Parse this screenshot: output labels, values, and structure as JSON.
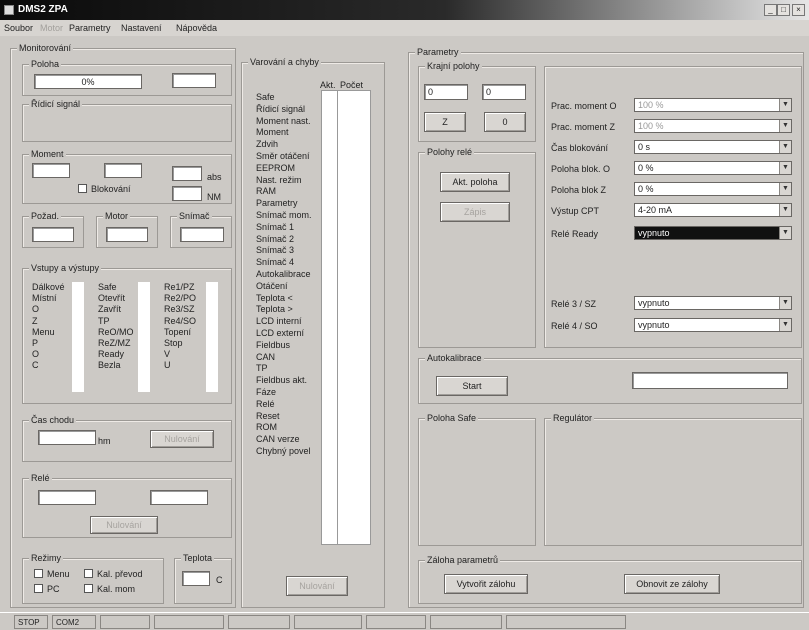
{
  "title": "DMS2 ZPA",
  "menu": [
    "Soubor",
    "Motor",
    "Parametry",
    "Nastavení",
    "Nápověda"
  ],
  "left": {
    "monitorovani": "Monitorování",
    "poloha": {
      "label": "Poloha",
      "value": "0%",
      "value2": ""
    },
    "ridici": "Řídicí signál",
    "moment": {
      "label": "Moment",
      "unit1": "abs",
      "unit2": "NM",
      "blokovani": "Blokování"
    },
    "pozad": "Požad.",
    "motor": "Motor",
    "snimac": "Snímač",
    "vstupy": {
      "label": "Vstupy a výstupy",
      "col1": [
        "Dálkové",
        "Místní",
        "O",
        "Z",
        "Menu",
        "P",
        "O",
        "C"
      ],
      "col2": [
        "Safe",
        "Otevřít",
        "Zavřít",
        "TP",
        "ReO/MO",
        "ReZ/MZ",
        "Ready",
        "Bezla"
      ],
      "col3": [
        "Re1/PZ",
        "Re2/PO",
        "Re3/SZ",
        "Re4/SO",
        "Topení",
        "Stop",
        "V",
        "U"
      ]
    },
    "cas": {
      "label": "Čas chodu",
      "unit": "hm",
      "button": "Nulování"
    },
    "rele": {
      "label": "Relé",
      "button": "Nulování"
    },
    "rezimy": {
      "label": "Režimy",
      "menu": "Menu",
      "pc": "PC",
      "kal_prev": "Kal. převod",
      "kal_mom": "Kal. mom"
    },
    "teplota": {
      "label": "Teplota",
      "unit": "C"
    }
  },
  "varovani": {
    "label": "Varování a chyby",
    "col_akt": "Akt.",
    "col_pocet": "Počet",
    "items": [
      "Safe",
      "Řídicí signál",
      "Moment nast.",
      "Moment",
      "Zdvih",
      "Směr otáčení",
      "EEPROM",
      "Nast. režim",
      "RAM",
      "Parametry",
      "Snímač mom.",
      "Snímač 1",
      "Snímač 2",
      "Snímač 3",
      "Snímač 4",
      "Autokalibrace",
      "Otáčení",
      "Teplota <",
      "Teplota >",
      "LCD interní",
      "LCD externí",
      "Fieldbus",
      "CAN",
      "TP",
      "Fieldbus akt.",
      "Fáze",
      "Relé",
      "Reset",
      "ROM",
      "CAN verze",
      "Chybný povel"
    ],
    "button": "Nulování"
  },
  "parametry": {
    "label": "Parametry",
    "krajni": {
      "label": "Krajní polohy",
      "v1": "0",
      "v2": "0",
      "b1": "Z",
      "b2": "0"
    },
    "polohy_rele": {
      "label": "Polohy relé",
      "b1": "Akt. poloha",
      "b2": "Zápis"
    },
    "fields": [
      {
        "label": "Prac. moment O",
        "value": "100 %",
        "state": "dis"
      },
      {
        "label": "Prac. moment Z",
        "value": "100 %",
        "state": "dis"
      },
      {
        "label": "Čas blokování",
        "value": "0 s",
        "state": ""
      },
      {
        "label": "Poloha blok. O",
        "value": "0 %",
        "state": ""
      },
      {
        "label": "Poloha blok Z",
        "value": "0 %",
        "state": ""
      },
      {
        "label": "Výstup CPT",
        "value": "4-20 mA",
        "state": ""
      },
      {
        "label": "Relé Ready",
        "value": "vypnuto",
        "state": "sel"
      },
      {
        "label": "Relé 3 / SZ",
        "value": "vypnuto",
        "state": ""
      },
      {
        "label": "Relé 4 / SO",
        "value": "vypnuto",
        "state": ""
      }
    ],
    "autokal": {
      "label": "Autokalibrace",
      "button": "Start"
    },
    "poloha_safe": "Poloha Safe",
    "regulator": "Regulátor",
    "zaloha": {
      "label": "Záloha parametrů",
      "b1": "Vytvořit zálohu",
      "b2": "Obnovit ze zálohy"
    }
  },
  "status": [
    "STOP",
    "COM2",
    "",
    "",
    "",
    "",
    "",
    "",
    ""
  ]
}
